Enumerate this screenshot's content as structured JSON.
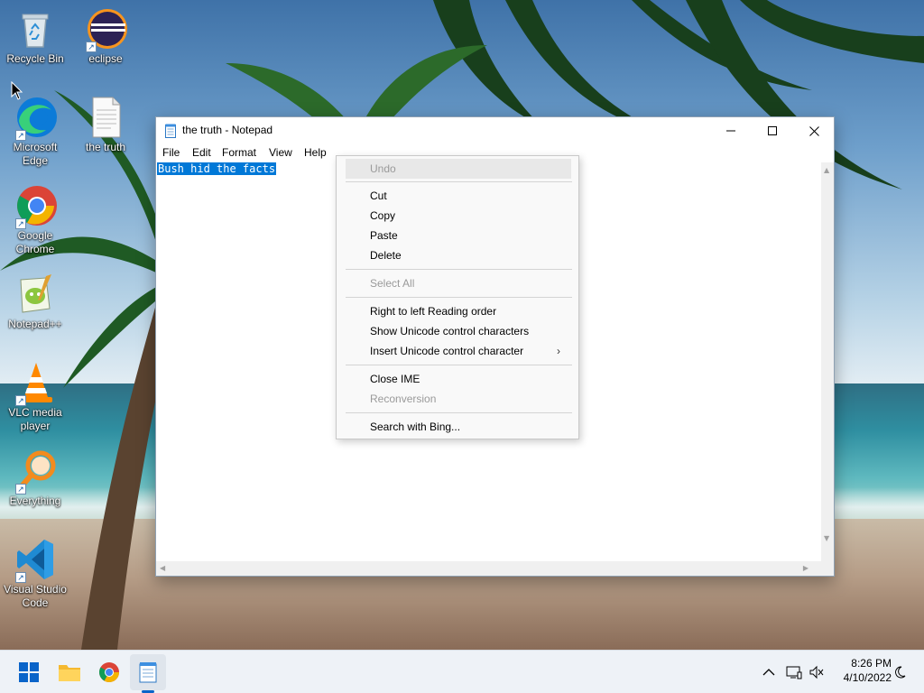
{
  "desktop": {
    "icons": [
      {
        "label": "Recycle Bin"
      },
      {
        "label": "eclipse"
      },
      {
        "label": "Microsoft Edge"
      },
      {
        "label": "the truth"
      },
      {
        "label": "Google Chrome"
      },
      {
        "label": "Notepad++"
      },
      {
        "label": "VLC media player"
      },
      {
        "label": "Everything"
      },
      {
        "label": "Visual Studio Code"
      }
    ]
  },
  "notepad": {
    "title": "the truth - Notepad",
    "menu": [
      "File",
      "Edit",
      "Format",
      "View",
      "Help"
    ],
    "content": "Bush hid the facts",
    "selection_color": "#0078d7"
  },
  "context_menu": {
    "items": [
      {
        "label": "Undo",
        "enabled": false
      },
      {
        "label": "Cut",
        "enabled": true
      },
      {
        "label": "Copy",
        "enabled": true
      },
      {
        "label": "Paste",
        "enabled": true
      },
      {
        "label": "Delete",
        "enabled": true
      },
      {
        "label": "Select All",
        "enabled": false
      },
      {
        "label": "Right to left Reading order",
        "enabled": true
      },
      {
        "label": "Show Unicode control characters",
        "enabled": true
      },
      {
        "label": "Insert Unicode control character",
        "enabled": true,
        "submenu_glyph": "›"
      },
      {
        "label": "Close IME",
        "enabled": true
      },
      {
        "label": "Reconversion",
        "enabled": false
      },
      {
        "label": "Search with Bing...",
        "enabled": true
      }
    ]
  },
  "taskbar": {
    "apps": [
      "start-icon",
      "file-explorer-icon",
      "chrome-icon",
      "notepad-icon"
    ],
    "active_app": "notepad-icon",
    "accent": "#0a64c9",
    "clock": {
      "time": "8:26 PM",
      "date": "4/10/2022"
    }
  }
}
